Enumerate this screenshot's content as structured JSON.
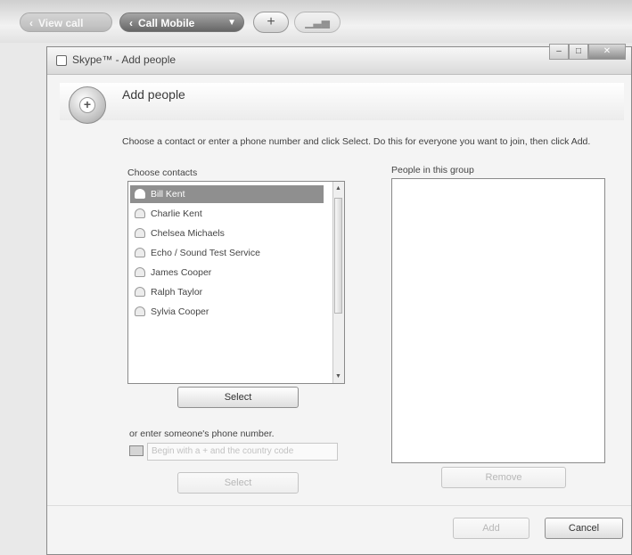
{
  "toolbar": {
    "view_label": "View call",
    "call_label": "Call Mobile",
    "add_symbol": "+",
    "chart_icon": "bar-chart-icon"
  },
  "dialog": {
    "window_title": "Skype™ - Add people",
    "heading": "Add people",
    "instructions": "Choose a contact or enter a phone number and click Select. Do this for everyone you want to join, then click Add.",
    "choose_contacts_label": "Choose contacts",
    "people_in_group_label": "People in this group",
    "contacts": [
      {
        "name": "Bill Kent",
        "selected": true
      },
      {
        "name": "Charlie Kent",
        "selected": false
      },
      {
        "name": "Chelsea Michaels",
        "selected": false
      },
      {
        "name": "Echo / Sound Test Service",
        "selected": false
      },
      {
        "name": "James Cooper",
        "selected": false
      },
      {
        "name": "Ralph Taylor",
        "selected": false
      },
      {
        "name": "Sylvia Cooper",
        "selected": false
      }
    ],
    "select_button": "Select",
    "phone_label": "or enter someone's phone number.",
    "phone_placeholder": "Begin with a + and the country code",
    "select_button_2": "Select",
    "remove_button": "Remove",
    "add_button": "Add",
    "cancel_button": "Cancel"
  }
}
